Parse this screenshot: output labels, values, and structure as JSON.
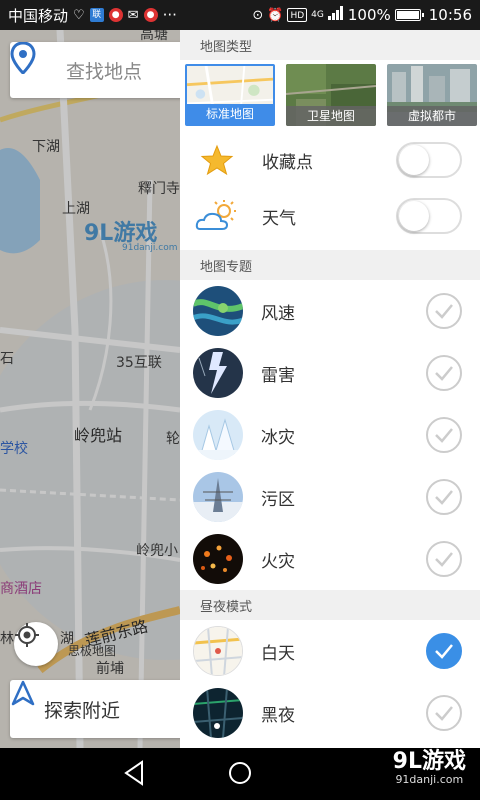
{
  "status_bar": {
    "carrier": "中国移动",
    "battery": "100%",
    "battery_level": 1.0,
    "time": "10:56",
    "network": "4G",
    "hd": "HD",
    "more": "···"
  },
  "map": {
    "search_placeholder": "查找地点",
    "explore_label": "探索附近",
    "labels": {
      "gaotang": "高塘",
      "xiahu": "下湖",
      "shanghu": "上湖",
      "yanjiang": "釋门寺",
      "sanwu": "35互联",
      "lingdou": "岭兜站",
      "lingdouxiao": "岭兜小",
      "school": "学校",
      "hotel": "商酒店",
      "lianqian": "莲前东路",
      "qianpu": "前埔",
      "sijimap": "思极地图",
      "lin": "林",
      "hu": "湖",
      "shi": "石",
      "ke": "轮"
    },
    "watermark": "9L游戏",
    "watermark_sub": "91danji.com"
  },
  "drawer": {
    "map_type_header": "地图类型",
    "map_types": [
      {
        "label": "标准地图",
        "selected": true
      },
      {
        "label": "卫星地图",
        "selected": false
      },
      {
        "label": "虚拟都市",
        "selected": false
      }
    ],
    "favorites_label": "收藏点",
    "favorites_on": false,
    "weather_label": "天气",
    "weather_on": false,
    "topic_header": "地图专题",
    "topics": [
      {
        "label": "风速",
        "checked": false
      },
      {
        "label": "雷害",
        "checked": false
      },
      {
        "label": "冰灾",
        "checked": false
      },
      {
        "label": "污区",
        "checked": false
      },
      {
        "label": "火灾",
        "checked": false
      }
    ],
    "daynight_header": "昼夜模式",
    "modes": [
      {
        "label": "白天",
        "checked": true
      },
      {
        "label": "黑夜",
        "checked": false
      }
    ]
  },
  "nav": {
    "watermark": "9L游戏",
    "watermark_sub": "91danji.com"
  },
  "colors": {
    "accent": "#3a8fe6",
    "status_bg": "#1a1a1a",
    "section_bg": "#f0f0f0"
  }
}
